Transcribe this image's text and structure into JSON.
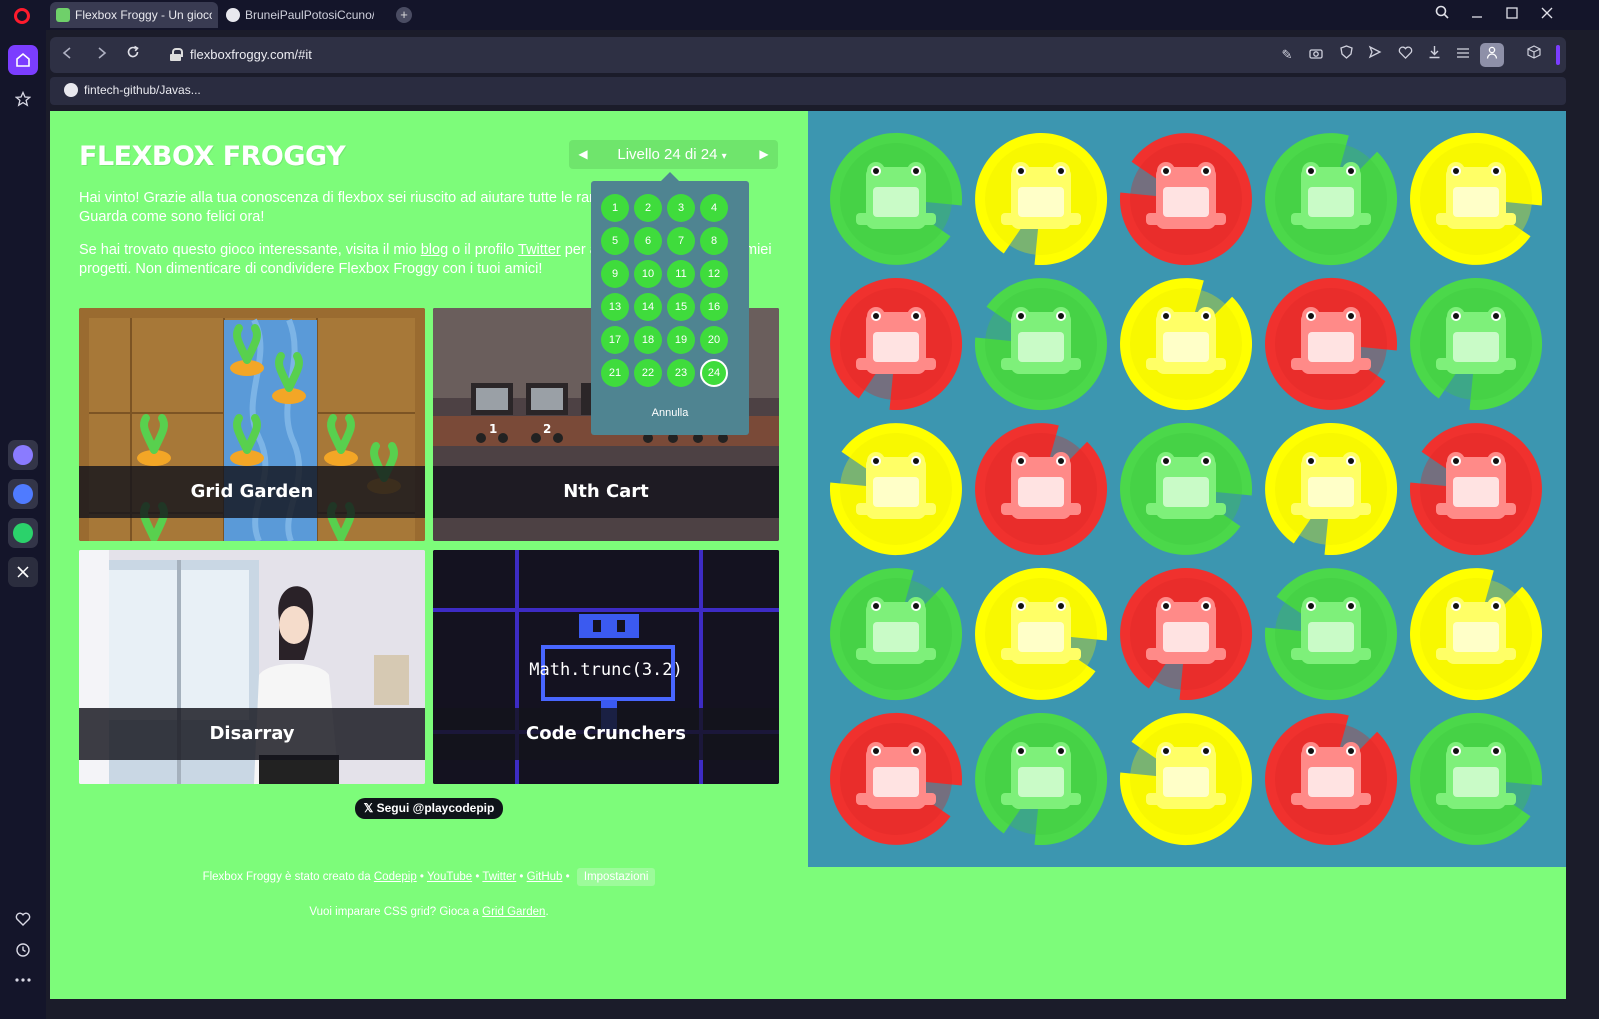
{
  "browser": {
    "tabs": [
      {
        "title": "Flexbox Froggy - Un gioco",
        "active": true
      },
      {
        "title": "BruneiPaulPotosiCcuno/ht",
        "active": false
      }
    ],
    "new_tab_label": "+",
    "url": "flexboxfroggy.com/#it",
    "bookmarks": [
      {
        "title": "fintech-github/Javas..."
      }
    ]
  },
  "game": {
    "logo": "FLEXBOX FROGGY",
    "level_label": "Livello 24 di 24",
    "level_caret": "▾",
    "prev_arrow": "◀",
    "next_arrow": "▶",
    "win_text": {
      "line1": "Hai vinto! Grazie alla tua conoscenza di flexbox sei riuscito ad aiutare tutte le rane",
      "line2": "Guarda come sono felici ora!"
    },
    "info_text": {
      "before_blog": "Se hai trovato questo gioco interessante, visita il mio ",
      "blog": "blog",
      "between": " o il profilo ",
      "twitter": "Twitter",
      "after": " per a",
      "tail": "miei",
      "line2": "progetti. Non dimenticare di condividere Flexbox Froggy con i tuoi amici!"
    },
    "dropdown": {
      "levels": [
        "1",
        "2",
        "3",
        "4",
        "5",
        "6",
        "7",
        "8",
        "9",
        "10",
        "11",
        "12",
        "13",
        "14",
        "15",
        "16",
        "17",
        "18",
        "19",
        "20",
        "21",
        "22",
        "23",
        "24"
      ],
      "current": "24",
      "cancel_label": "Annulla"
    },
    "cards": {
      "grid_garden": "Grid Garden",
      "nth_cart": "Nth Cart",
      "disarray": "Disarray",
      "code_crunchers": "Code Crunchers",
      "cart_numbers": [
        "1",
        "2"
      ],
      "code_sample": "Math.trunc(3.2)"
    },
    "follow_button": "𝕏 Segui @playcodepip",
    "footer": {
      "created_by": "Flexbox Froggy è stato creato da ",
      "codepip": "Codepip",
      "sep": " • ",
      "youtube": "YouTube",
      "twitter": "Twitter",
      "github": "GitHub",
      "settings": "Impostazioni",
      "grid_prompt": "Vuoi imparare CSS grid? Gioca a ",
      "grid_link": "Grid Garden",
      "grid_end": "."
    },
    "pond_rows": [
      [
        "green",
        "yellow",
        "red",
        "green",
        "yellow"
      ],
      [
        "red",
        "green",
        "yellow",
        "red",
        "green"
      ],
      [
        "yellow",
        "red",
        "green",
        "yellow",
        "red"
      ],
      [
        "green",
        "yellow",
        "red",
        "green",
        "yellow"
      ],
      [
        "red",
        "green",
        "yellow",
        "red",
        "green"
      ]
    ],
    "colors": {
      "page_bg": "#7dfc7a",
      "pond": "#3c96b0",
      "green": "#4bd84a",
      "yellow": "#ffff00",
      "red": "#f0312e"
    }
  }
}
